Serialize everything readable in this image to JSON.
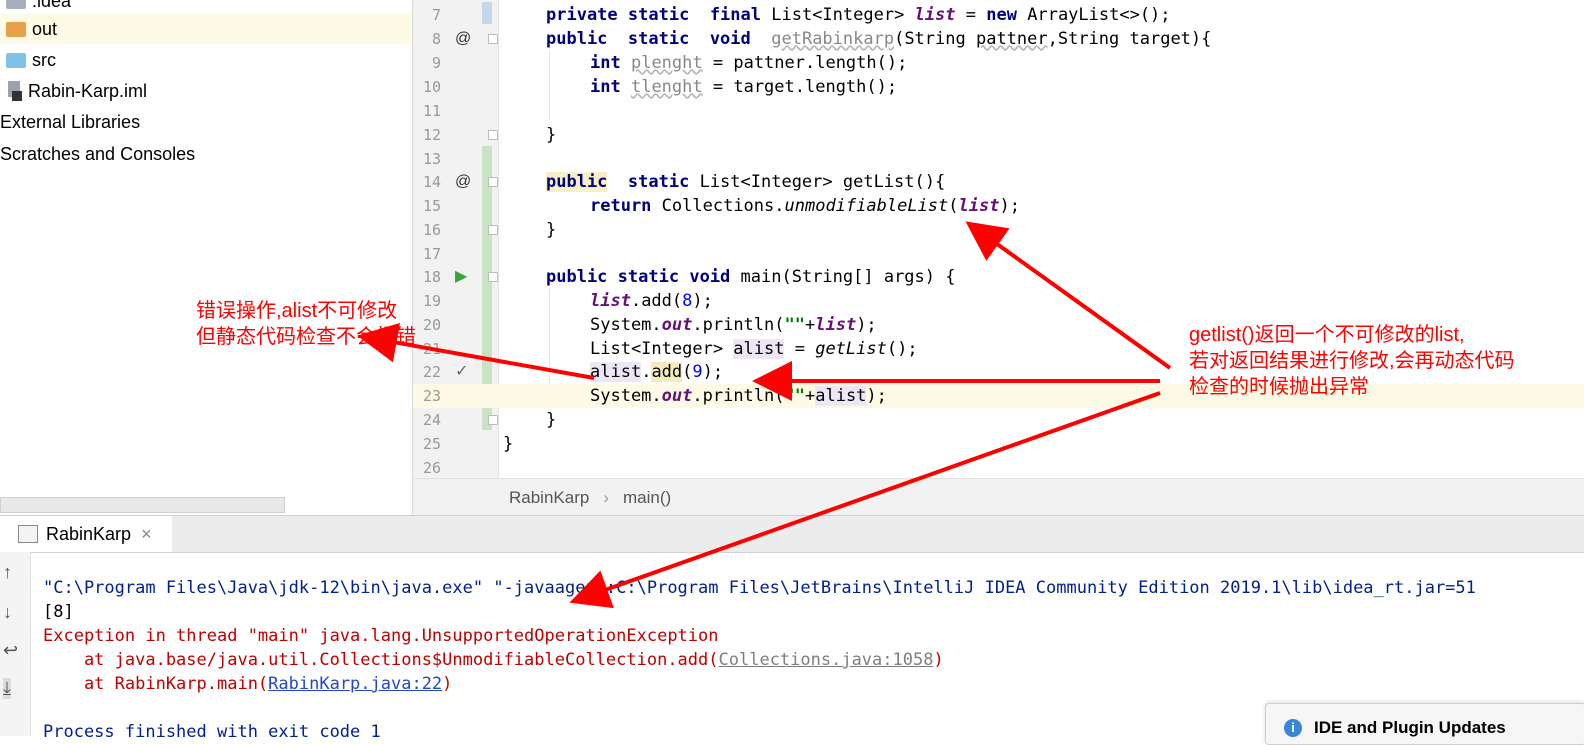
{
  "sidebar": {
    "items": [
      {
        "label": ".idea",
        "icon": "folder-icon"
      },
      {
        "label": "out",
        "icon": "folder-orange-icon"
      },
      {
        "label": "src",
        "icon": "folder-blue-icon"
      },
      {
        "label": "Rabin-Karp.iml",
        "icon": "module-file-icon"
      },
      {
        "label": "External Libraries",
        "icon": ""
      },
      {
        "label": "Scratches and Consoles",
        "icon": ""
      }
    ]
  },
  "editor": {
    "line_numbers": [
      "7",
      "8",
      "9",
      "10",
      "11",
      "12",
      "13",
      "14",
      "15",
      "16",
      "17",
      "18",
      "19",
      "20",
      "21",
      "22",
      "23",
      "24",
      "25",
      "26"
    ],
    "markers": {
      "at": "@",
      "run": "▶",
      "check": "✓"
    },
    "code": {
      "l7": {
        "kw1": "private",
        "kw2": "static",
        "kw3": "final",
        "t1": "List<Integer>",
        "fld": "list",
        "t2": "=",
        "kw4": "new",
        "t3": "ArrayList<>();"
      },
      "l8": {
        "kw1": "public",
        "kw2": "static",
        "kw3": "void",
        "name": "getRabinkarp",
        "p1": "(String ",
        "p2": "pattner",
        "p3": ",String target){"
      },
      "l9": {
        "kw": "int",
        "var": "plenght",
        "rest": "= pattner.length();"
      },
      "l10": {
        "kw": "int",
        "var": "tlenght",
        "rest": "= target.length();"
      },
      "l12": {
        "brace": "}"
      },
      "l14": {
        "kw1": "public",
        "kw2": "static",
        "rest": "List<Integer> getList(){"
      },
      "l15": {
        "kw": "return",
        "t1": "Collections.",
        "method": "unmodifiableList",
        "t2": "(",
        "fld": "list",
        "t3": ");"
      },
      "l16": {
        "brace": "}"
      },
      "l18": {
        "kw1": "public",
        "kw2": "static",
        "kw3": "void",
        "rest": "main(String[] args) {"
      },
      "l19": {
        "fld": "list",
        "t1": ".add(",
        "num": "8",
        "t2": ");"
      },
      "l20": {
        "t1": "System.",
        "fld": "out",
        "t2": ".println(",
        "str": "\"\"",
        "t3": "+",
        "fld2": "list",
        "t4": ");"
      },
      "l21": {
        "t1": "List<Integer> ",
        "var": "alist",
        "t2": " = ",
        "method": "getList",
        "t3": "();"
      },
      "l22": {
        "var": "alist",
        "t1": ".",
        "method": "add",
        "t2": "(",
        "num": "9",
        "t3": ");"
      },
      "l23": {
        "t1": "System.",
        "fld": "out",
        "t2": ".println(",
        "str": "\"\"",
        "t3": "+",
        "var": "alist",
        "t4": ");"
      },
      "l24": {
        "brace": "}"
      },
      "l25": {
        "brace": "}"
      }
    },
    "breadcrumb": {
      "class": "RabinKarp",
      "sep": "›",
      "method": "main()"
    }
  },
  "run": {
    "tab_label": "RabinKarp",
    "close": "×",
    "toolbar": [
      "↑",
      "↓",
      "↩",
      "⤓"
    ],
    "console": {
      "cmd": "\"C:\\Program Files\\Java\\jdk-12\\bin\\java.exe\" \"-javaagent:C:\\Program Files\\JetBrains\\IntelliJ IDEA Community Edition 2019.1\\lib\\idea_rt.jar=51",
      "out1": "[8]",
      "exc": "Exception in thread \"main\" java.lang.UnsupportedOperationException",
      "at1_prefix": "    at java.base/java.util.Collections$UnmodifiableCollection.add(",
      "at1_link": "Collections.java:1058",
      "at1_suffix": ")",
      "at2_prefix": "    at RabinKarp.main(",
      "at2_link": "RabinKarp.java:22",
      "at2_suffix": ")",
      "finish": "Process finished with exit code 1"
    }
  },
  "popup": {
    "icon": "i",
    "title": "IDE and Plugin Updates"
  },
  "annotations": {
    "left_l1": "错误操作,alist不可修改",
    "left_l2": "但静态代码检查不会报错",
    "right_l1": "getlist()返回一个不可修改的list,",
    "right_l2": "若对返回结果进行修改,会再动态代码",
    "right_l3": "检查的时候抛出异常",
    "color": "#ff0000"
  }
}
